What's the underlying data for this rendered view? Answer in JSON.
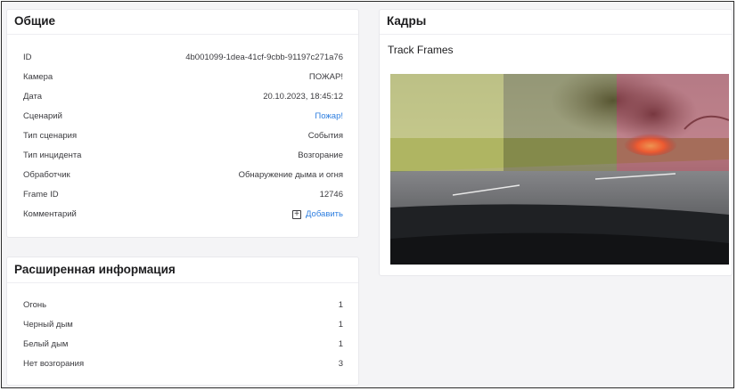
{
  "general": {
    "title": "Общие",
    "rows": [
      {
        "label": "ID",
        "value": "4b001099-1dea-41cf-9cbb-91197c271a76"
      },
      {
        "label": "Камера",
        "value": "ПОЖАР!"
      },
      {
        "label": "Дата",
        "value": "20.10.2023, 18:45:12"
      },
      {
        "label": "Сценарий",
        "value": "Пожар!"
      },
      {
        "label": "Тип сценария",
        "value": "События"
      },
      {
        "label": "Тип инцидента",
        "value": "Возгорание"
      },
      {
        "label": "Обработчик",
        "value": "Обнаружение дыма и огня"
      },
      {
        "label": "Frame ID",
        "value": "12746"
      },
      {
        "label": "Комментарий",
        "value": "Добавить"
      }
    ]
  },
  "extended": {
    "title": "Расширенная информация",
    "rows": [
      {
        "label": "Огонь",
        "value": "1"
      },
      {
        "label": "Черный дым",
        "value": "1"
      },
      {
        "label": "Белый дым",
        "value": "1"
      },
      {
        "label": "Нет возгорания",
        "value": "3"
      }
    ]
  },
  "frames": {
    "title": "Кадры",
    "subtitle": "Track Frames",
    "overlay_colors": {
      "fire": "#d84a5a",
      "black_smoke": "#8e8a3a",
      "white_smoke": "#d8d86a"
    }
  },
  "colors": {
    "link": "#2f7fe0",
    "border": "#2b2b2b",
    "background": "#f4f4f6"
  },
  "icons": {
    "add": "plus-square-icon"
  }
}
